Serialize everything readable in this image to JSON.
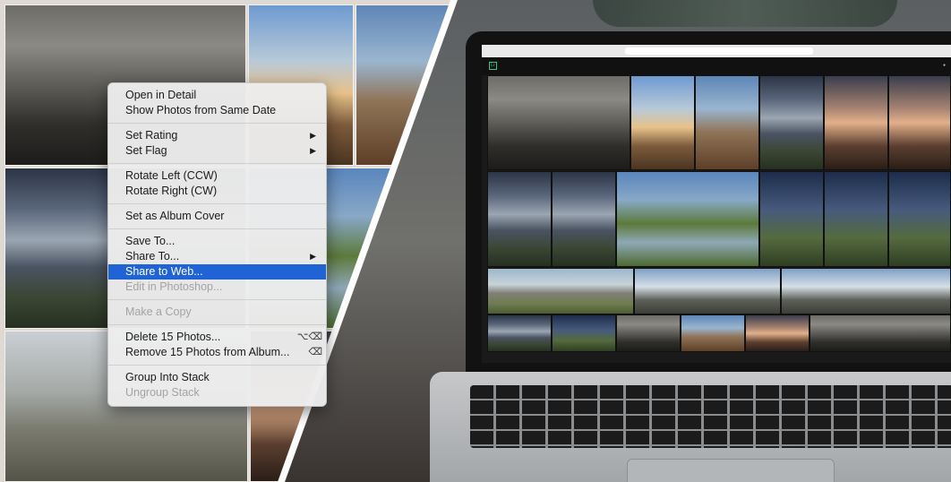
{
  "context_menu": {
    "groups": [
      [
        {
          "label": "Open in Detail"
        },
        {
          "label": "Show Photos from Same Date"
        }
      ],
      [
        {
          "label": "Set Rating",
          "submenu": true
        },
        {
          "label": "Set Flag",
          "submenu": true
        }
      ],
      [
        {
          "label": "Rotate Left (CCW)"
        },
        {
          "label": "Rotate Right (CW)"
        }
      ],
      [
        {
          "label": "Set as Album Cover"
        }
      ],
      [
        {
          "label": "Save To..."
        },
        {
          "label": "Share To...",
          "submenu": true
        },
        {
          "label": "Share to Web...",
          "highlighted": true
        },
        {
          "label": "Edit in Photoshop...",
          "disabled": true
        }
      ],
      [
        {
          "label": "Make a Copy",
          "disabled": true
        }
      ],
      [
        {
          "label": "Delete 15 Photos...",
          "shortcut": "⌥⌫"
        },
        {
          "label": "Remove 15 Photos from Album...",
          "shortcut": "⌫"
        }
      ],
      [
        {
          "label": "Group Into Stack"
        },
        {
          "label": "Ungroup Stack",
          "disabled": true
        }
      ]
    ],
    "colors": {
      "highlight": "#1f63d4",
      "disabled_text": "#a3a3a3",
      "background": "#ececec"
    },
    "icons": {
      "submenu": "chevron-right-icon",
      "delete_shortcut": "option-delete-icon",
      "remove_shortcut": "delete-key-icon"
    }
  },
  "laptop_app": {
    "logo_text": "Lr",
    "icons": [
      "app-logo-icon",
      "account-icon"
    ]
  },
  "accent_color": "#39c28b"
}
